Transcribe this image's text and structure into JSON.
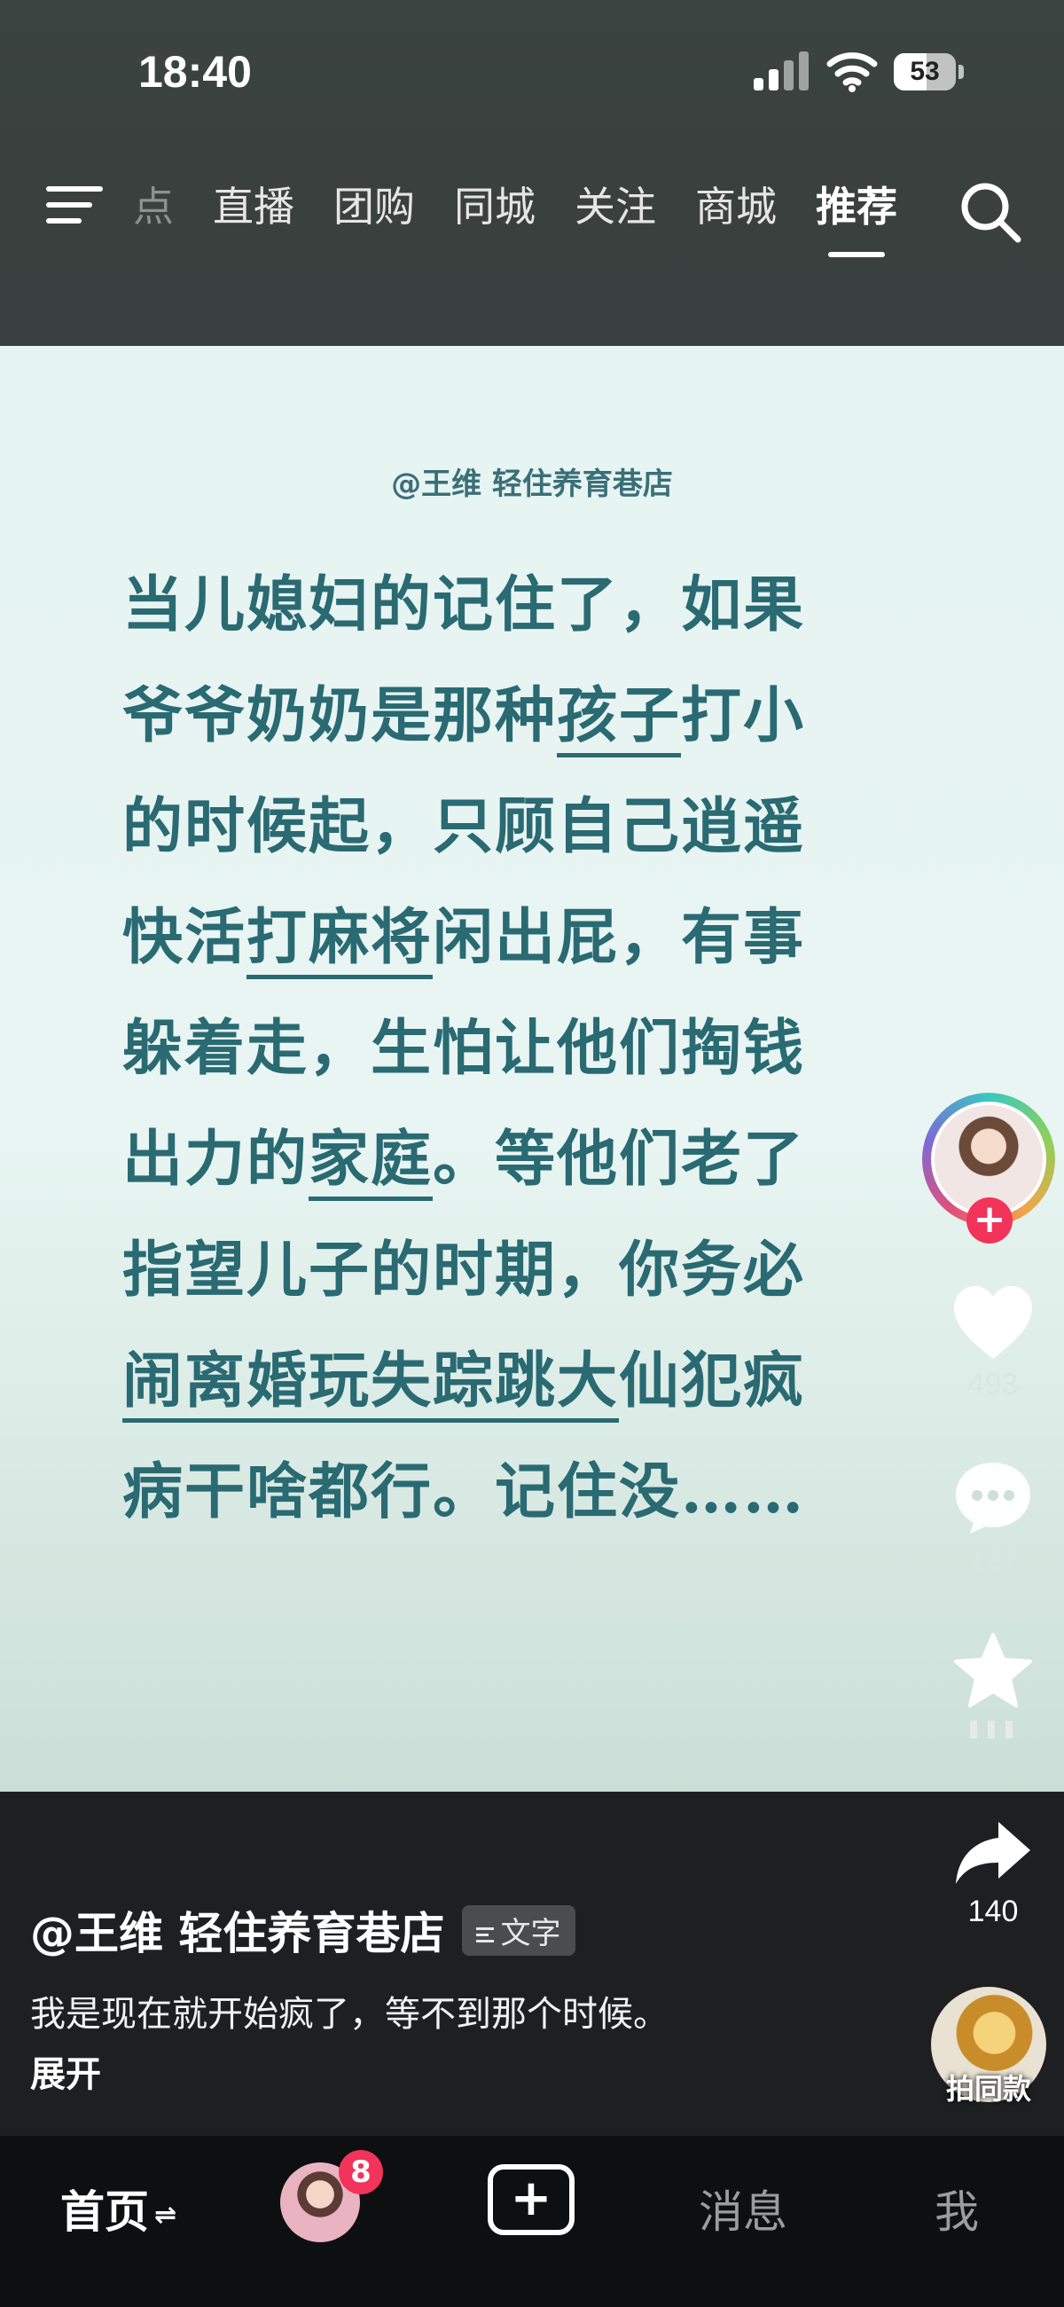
{
  "status_bar": {
    "time": "18:40",
    "battery": "53",
    "battery_fraction": 0.53
  },
  "top_nav": {
    "tabs": [
      {
        "label": "点",
        "state": "faded"
      },
      {
        "label": "直播",
        "state": "normal"
      },
      {
        "label": "团购",
        "state": "normal"
      },
      {
        "label": "同城",
        "state": "normal"
      },
      {
        "label": "关注",
        "state": "normal"
      },
      {
        "label": "商城",
        "state": "normal"
      },
      {
        "label": "推荐",
        "state": "active"
      }
    ],
    "menu_icon": "menu-icon",
    "search_icon": "search-icon"
  },
  "video": {
    "author_tag": "@王维 轻住养育巷店",
    "lines": [
      "当儿媳妇的记住了，如果",
      "爷爷奶奶是那种<u>孩子</u>打小",
      "的时候起，只顾自己逍遥",
      "快活<u>打麻将</u>闲出屁，有事",
      "躲着走，生怕让他们掏钱",
      "出力的<u>家庭</u>。等他们老了",
      "指望儿子的时期，你务必",
      "<u>闹离婚玩失踪跳大</u>仙犯疯",
      "病干啥都行。记住没……"
    ]
  },
  "rail": {
    "follow_label": "+",
    "likes": "493",
    "comments": "127",
    "shares": "140"
  },
  "caption": {
    "author": "@王维 轻住养育巷店",
    "type_badge": "文字",
    "text": "我是现在就开始疯了，等不到那个时候。",
    "expand": "展开",
    "same_style": "拍同款"
  },
  "tab_bar": {
    "home": "首页",
    "friends_badge": "8",
    "create": "+",
    "messages": "消息",
    "me": "我"
  },
  "colors": {
    "accent_red": "#f2345a",
    "text_teal": "#2a6a72"
  }
}
